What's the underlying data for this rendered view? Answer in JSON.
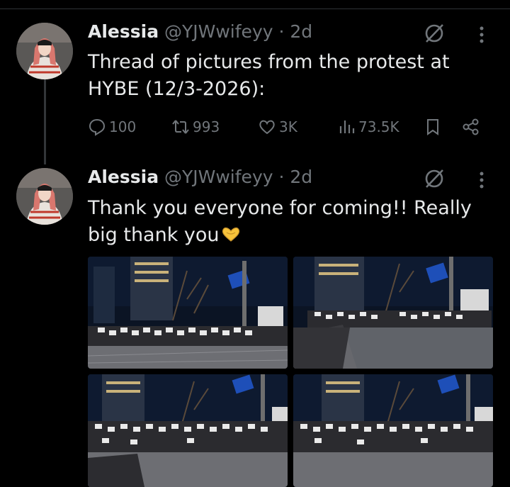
{
  "tweet1": {
    "name": "Alessia",
    "handle": "@YJWwifeyy · 2d",
    "text_line1": "Thread of pictures from the protest at",
    "text_line2": "HYBE (12/3-2026):",
    "replies": "100",
    "reposts": "993",
    "likes": "3K",
    "views": "73.5K"
  },
  "tweet2": {
    "name": "Alessia",
    "handle": "@YJWwifeyy · 2d",
    "text_line1": "Thank you everyone for coming!! Really",
    "text_line2": "big thank you",
    "emoji": "🫶"
  },
  "colors": {
    "background": "#000000",
    "text": "#e7e9ea",
    "muted": "#71767b",
    "emoji": "#f7c33b"
  },
  "icons": [
    "reply-icon",
    "repost-icon",
    "like-icon",
    "views-icon",
    "bookmark-icon",
    "share-icon",
    "grok-icon",
    "more-icon"
  ],
  "media": [
    {
      "name": "protest-photo-1"
    },
    {
      "name": "protest-photo-2"
    },
    {
      "name": "protest-photo-3"
    },
    {
      "name": "protest-photo-4"
    }
  ]
}
